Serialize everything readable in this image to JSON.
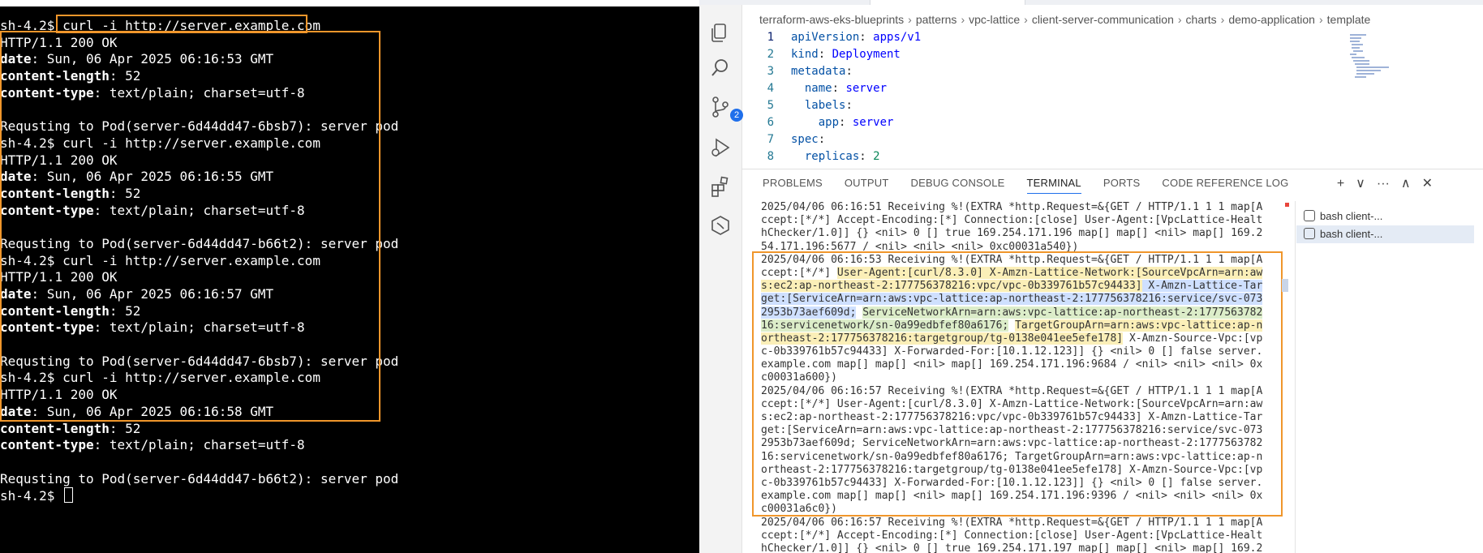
{
  "left_terminal": {
    "lines": [
      [
        {
          "t": "sh-4.2$ curl -i http://server.example.com",
          "b": false
        }
      ],
      [
        {
          "t": "HTTP/1.1 200 OK",
          "b": false
        }
      ],
      [
        {
          "t": "date",
          "b": true
        },
        {
          "t": ": Sun, 06 Apr 2025 06:16:53 GMT",
          "b": false
        }
      ],
      [
        {
          "t": "content-length",
          "b": true
        },
        {
          "t": ": 52",
          "b": false
        }
      ],
      [
        {
          "t": "content-type",
          "b": true
        },
        {
          "t": ": text/plain; charset=utf-8",
          "b": false
        }
      ],
      [
        {
          "t": "",
          "b": false
        }
      ],
      [
        {
          "t": "Requsting to Pod(server-6d44dd47-6bsb7): server pod",
          "b": false
        }
      ],
      [
        {
          "t": "sh-4.2$ curl -i http://server.example.com",
          "b": false
        }
      ],
      [
        {
          "t": "HTTP/1.1 200 OK",
          "b": false
        }
      ],
      [
        {
          "t": "date",
          "b": true
        },
        {
          "t": ": Sun, 06 Apr 2025 06:16:55 GMT",
          "b": false
        }
      ],
      [
        {
          "t": "content-length",
          "b": true
        },
        {
          "t": ": 52",
          "b": false
        }
      ],
      [
        {
          "t": "content-type",
          "b": true
        },
        {
          "t": ": text/plain; charset=utf-8",
          "b": false
        }
      ],
      [
        {
          "t": "",
          "b": false
        }
      ],
      [
        {
          "t": "Requsting to Pod(server-6d44dd47-b66t2): server pod",
          "b": false
        }
      ],
      [
        {
          "t": "sh-4.2$ curl -i http://server.example.com",
          "b": false
        }
      ],
      [
        {
          "t": "HTTP/1.1 200 OK",
          "b": false
        }
      ],
      [
        {
          "t": "date",
          "b": true
        },
        {
          "t": ": Sun, 06 Apr 2025 06:16:57 GMT",
          "b": false
        }
      ],
      [
        {
          "t": "content-length",
          "b": true
        },
        {
          "t": ": 52",
          "b": false
        }
      ],
      [
        {
          "t": "content-type",
          "b": true
        },
        {
          "t": ": text/plain; charset=utf-8",
          "b": false
        }
      ],
      [
        {
          "t": "",
          "b": false
        }
      ],
      [
        {
          "t": "Requsting to Pod(server-6d44dd47-6bsb7): server pod",
          "b": false
        }
      ],
      [
        {
          "t": "sh-4.2$ curl -i http://server.example.com",
          "b": false
        }
      ],
      [
        {
          "t": "HTTP/1.1 200 OK",
          "b": false
        }
      ],
      [
        {
          "t": "date",
          "b": true
        },
        {
          "t": ": Sun, 06 Apr 2025 06:16:58 GMT",
          "b": false
        }
      ],
      [
        {
          "t": "content-length",
          "b": true
        },
        {
          "t": ": 52",
          "b": false
        }
      ],
      [
        {
          "t": "content-type",
          "b": true
        },
        {
          "t": ": text/plain; charset=utf-8",
          "b": false
        }
      ],
      [
        {
          "t": "",
          "b": false
        }
      ],
      [
        {
          "t": "Requsting to Pod(server-6d44dd47-b66t2): server pod",
          "b": false
        }
      ]
    ],
    "prompt": "sh-4.2$ "
  },
  "breadcrumb": [
    "terraform-aws-eks-blueprints",
    "patterns",
    "vpc-lattice",
    "client-server-communication",
    "charts",
    "demo-application",
    "template"
  ],
  "activity_badge": "2",
  "editor": {
    "lines": [
      {
        "n": "1",
        "parts": [
          [
            "k",
            "apiVersion"
          ],
          [
            "p",
            ": "
          ],
          [
            "v",
            "apps/v1"
          ]
        ]
      },
      {
        "n": "2",
        "parts": [
          [
            "k",
            "kind"
          ],
          [
            "p",
            ": "
          ],
          [
            "v",
            "Deployment"
          ]
        ]
      },
      {
        "n": "3",
        "parts": [
          [
            "k",
            "metadata"
          ],
          [
            "p",
            ":"
          ]
        ]
      },
      {
        "n": "4",
        "parts": [
          [
            "p",
            "  "
          ],
          [
            "k",
            "name"
          ],
          [
            "p",
            ": "
          ],
          [
            "v",
            "server"
          ]
        ]
      },
      {
        "n": "5",
        "parts": [
          [
            "p",
            "  "
          ],
          [
            "k",
            "labels"
          ],
          [
            "p",
            ":"
          ]
        ]
      },
      {
        "n": "6",
        "parts": [
          [
            "p",
            "    "
          ],
          [
            "k",
            "app"
          ],
          [
            "p",
            ": "
          ],
          [
            "v",
            "server"
          ]
        ]
      },
      {
        "n": "7",
        "parts": [
          [
            "k",
            "spec"
          ],
          [
            "p",
            ":"
          ]
        ]
      },
      {
        "n": "8",
        "parts": [
          [
            "p",
            "  "
          ],
          [
            "k",
            "replicas"
          ],
          [
            "p",
            ": "
          ],
          [
            "num",
            "2"
          ]
        ]
      }
    ]
  },
  "panel": {
    "tabs": [
      "PROBLEMS",
      "OUTPUT",
      "DEBUG CONSOLE",
      "TERMINAL",
      "PORTS",
      "CODE REFERENCE LOG"
    ],
    "active_tab": "TERMINAL",
    "actions": [
      "+",
      "∨",
      "···",
      "∧",
      "✕"
    ]
  },
  "log_lines": [
    [
      [
        "",
        "2025/04/06 06:16:51 Receiving %!(EXTRA *http.Request=&{GET / HTTP/1.1 1 1 map[A"
      ]
    ],
    [
      [
        "",
        "ccept:[*/*] Accept-Encoding:[*] Connection:[close] User-Agent:[VpcLattice-Healt"
      ]
    ],
    [
      [
        "",
        "hChecker/1.0]] {} <nil> 0 [] true 169.254.171.196 map[] map[] <nil> map[] 169.2"
      ]
    ],
    [
      [
        "",
        "54.171.196:5677 / <nil> <nil> <nil> 0xc00031a540})"
      ]
    ],
    [
      [
        "",
        "2025/04/06 06:16:53 Receiving %!(EXTRA *http.Request=&{GET / HTTP/1.1 1 1 map[A"
      ]
    ],
    [
      [
        "",
        "ccept:[*/*] "
      ],
      [
        "y",
        "User-Agent:[curl/8.3.0] X-Amzn-Lattice-Network:[SourceVpcArn=arn:aw"
      ]
    ],
    [
      [
        "y",
        "s:ec2:ap-northeast-2:177756378216:vpc/vpc-0b339761b57c94433]"
      ],
      [
        "",
        ""
      ],
      [
        "b",
        " X-Amzn-Lattice-Tar"
      ]
    ],
    [
      [
        "b",
        "get:[ServiceArn=arn:aws:vpc-lattice:ap-northeast-2:177756378216:service/svc-073"
      ]
    ],
    [
      [
        "b",
        "2953b73aef609d;"
      ],
      [
        "",
        " "
      ],
      [
        "g",
        "ServiceNetworkArn=arn:aws:vpc-lattice:ap-northeast-2:1777563782"
      ]
    ],
    [
      [
        "g",
        "16:servicenetwork/sn-0a99edbfef80a6176;"
      ],
      [
        "",
        " "
      ],
      [
        "y",
        "TargetGroupArn=arn:aws:vpc-lattice:ap-n"
      ]
    ],
    [
      [
        "y",
        "ortheast-2:177756378216:targetgroup/tg-0138e041ee5efe178]"
      ],
      [
        "",
        " X-Amzn-Source-Vpc:[vp"
      ]
    ],
    [
      [
        "",
        "c-0b339761b57c94433] X-Forwarded-For:[10.1.12.123]] {} <nil> 0 [] false server."
      ]
    ],
    [
      [
        "",
        "example.com map[] map[] <nil> map[] 169.254.171.196:9684 / <nil> <nil> <nil> 0x"
      ]
    ],
    [
      [
        "",
        "c00031a600})"
      ]
    ],
    [
      [
        "",
        "2025/04/06 06:16:57 Receiving %!(EXTRA *http.Request=&{GET / HTTP/1.1 1 1 map[A"
      ]
    ],
    [
      [
        "",
        "ccept:[*/*] User-Agent:[curl/8.3.0] X-Amzn-Lattice-Network:[SourceVpcArn=arn:aw"
      ]
    ],
    [
      [
        "",
        "s:ec2:ap-northeast-2:177756378216:vpc/vpc-0b339761b57c94433] X-Amzn-Lattice-Tar"
      ]
    ],
    [
      [
        "",
        "get:[ServiceArn=arn:aws:vpc-lattice:ap-northeast-2:177756378216:service/svc-073"
      ]
    ],
    [
      [
        "",
        "2953b73aef609d; ServiceNetworkArn=arn:aws:vpc-lattice:ap-northeast-2:1777563782"
      ]
    ],
    [
      [
        "",
        "16:servicenetwork/sn-0a99edbfef80a6176; TargetGroupArn=arn:aws:vpc-lattice:ap-n"
      ]
    ],
    [
      [
        "",
        "ortheast-2:177756378216:targetgroup/tg-0138e041ee5efe178] X-Amzn-Source-Vpc:[vp"
      ]
    ],
    [
      [
        "",
        "c-0b339761b57c94433] X-Forwarded-For:[10.1.12.123]] {} <nil> 0 [] false server."
      ]
    ],
    [
      [
        "",
        "example.com map[] map[] <nil> map[] 169.254.171.196:9396 / <nil> <nil> <nil> 0x"
      ]
    ],
    [
      [
        "",
        "c00031a6c0})"
      ]
    ],
    [
      [
        "",
        "2025/04/06 06:16:57 Receiving %!(EXTRA *http.Request=&{GET / HTTP/1.1 1 1 map[A"
      ]
    ],
    [
      [
        "",
        "ccept:[*/*] Accept-Encoding:[*] Connection:[close] User-Agent:[VpcLattice-Healt"
      ]
    ],
    [
      [
        "",
        "hChecker/1.0]] {} <nil> 0 [] true 169.254.171.197 map[] map[] <nil> map[] 169.2"
      ]
    ]
  ],
  "terminal_list": [
    "bash  client-...",
    "bash  client-..."
  ],
  "colors": {
    "highlight": "#f0962b",
    "yellow_hl": "#fbefb8",
    "blue_hl": "#cfe0ff",
    "green_hl": "#dcedc9"
  }
}
